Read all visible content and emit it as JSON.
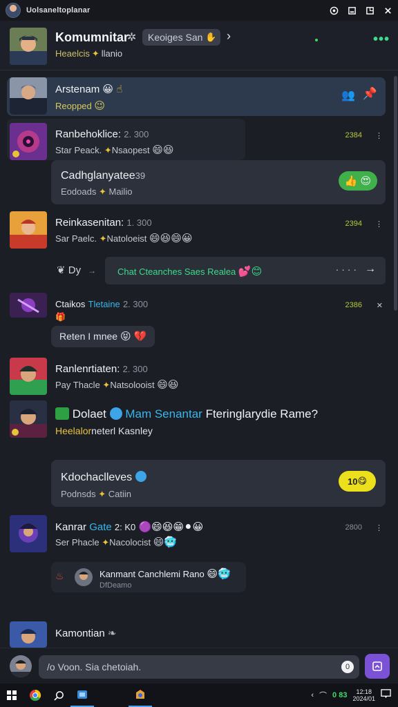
{
  "window": {
    "title": "Uolsaneltoplanar"
  },
  "header": {
    "title": "Komumnitar",
    "server_label": "Keoiges San",
    "subtitle_a": "Heaelcis",
    "subtitle_b": "llanio"
  },
  "messages": [
    {
      "name": "Arstenam",
      "sub": "Reopped",
      "selected": true
    },
    {
      "name": "Ranbehoklice:",
      "time": "2. 300",
      "sub_a": "Star Peack.",
      "sub_b": "Nsaopest",
      "num": "2384"
    },
    {
      "card_title": "Cadhglanyatee",
      "card_num": "39",
      "card_sub_a": "Eodoads",
      "card_sub_b": "Mailio"
    },
    {
      "name": "Reinkasenitan:",
      "time": "1. 300",
      "sub_a": "Sar Paelc.",
      "sub_b": "Natoloeist",
      "num": "2394"
    },
    {
      "thread_left": "Dy",
      "thread_text": "Chat Cteanches Saes Realea"
    },
    {
      "name": "Ctaikos",
      "name_b": "Tletaine",
      "time": "2. 300",
      "num": "2386",
      "bubble": "Reten I mnee"
    },
    {
      "name": "Ranlenrtiaten:",
      "time": "2. 300",
      "sub_a": "Pay Thacle",
      "sub_b": "Natsolooist"
    },
    {
      "big_a": "Dolaet",
      "big_b": "Mam Senantar",
      "big_c": "Fteringlarydie Rame?",
      "big_sub_a": "Heelalor",
      "big_sub_b": "neterl Kasnley"
    },
    {
      "card_title": "Kdochaclleves",
      "card_sub_a": "Podnsds",
      "card_sub_b": "Catiin",
      "react": "10"
    },
    {
      "name": "Kanrar",
      "name_b": "Gate",
      "time": "2: K0",
      "sub_a": "Ser Phacle",
      "sub_b": "Nacolocist",
      "num": "2800"
    },
    {
      "reply": "Kanmant Canchlemi Rano",
      "reply_sub": "DfDeamo"
    },
    {
      "name": "Kamontian"
    }
  ],
  "composer": {
    "placeholder": "/o Voon. Sia chetoiah.",
    "badge": "0"
  },
  "taskbar": {
    "tray_num": "0 83",
    "clock_a": "12:18",
    "clock_b": "2024/01"
  }
}
